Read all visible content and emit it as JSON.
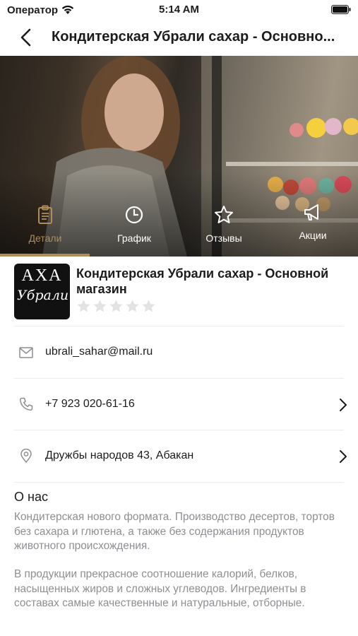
{
  "status_bar": {
    "carrier": "Оператор",
    "time": "5:14 AM"
  },
  "nav": {
    "title": "Кондитерская Убрали сахар - Основно..."
  },
  "tabs": [
    {
      "label": "Детали",
      "icon": "clipboard-icon",
      "active": true
    },
    {
      "label": "График",
      "icon": "clock-icon",
      "active": false
    },
    {
      "label": "Отзывы",
      "icon": "star-outline-icon",
      "active": false
    },
    {
      "label": "Акции",
      "icon": "megaphone-icon",
      "active": false
    }
  ],
  "store": {
    "logo_top": "АХА",
    "logo_script": "Убрали",
    "name": "Кондитерская Убрали сахар - Основной магазин",
    "rating": 0,
    "rating_max": 5
  },
  "contacts": {
    "email": "ubrali_sahar@mail.ru",
    "phone": "+7 923 020-61-16",
    "address": "Дружбы народов 43, Абакан"
  },
  "about": {
    "title": "О нас",
    "paragraph1": "Кондитерская нового формата. Производство десертов, тортов без сахара и глютена, а также без содержания продуктов животного происхождения.",
    "paragraph2": "В продукции прекрасное соотношение калорий, белков, насыщенных жиров и сложных углеводов. Ингредиенты в составах самые качественные и натуральные, отборные."
  },
  "colors": {
    "accent": "#b08d57",
    "muted_text": "#8e8e93",
    "star_empty": "#e3e3e3"
  }
}
